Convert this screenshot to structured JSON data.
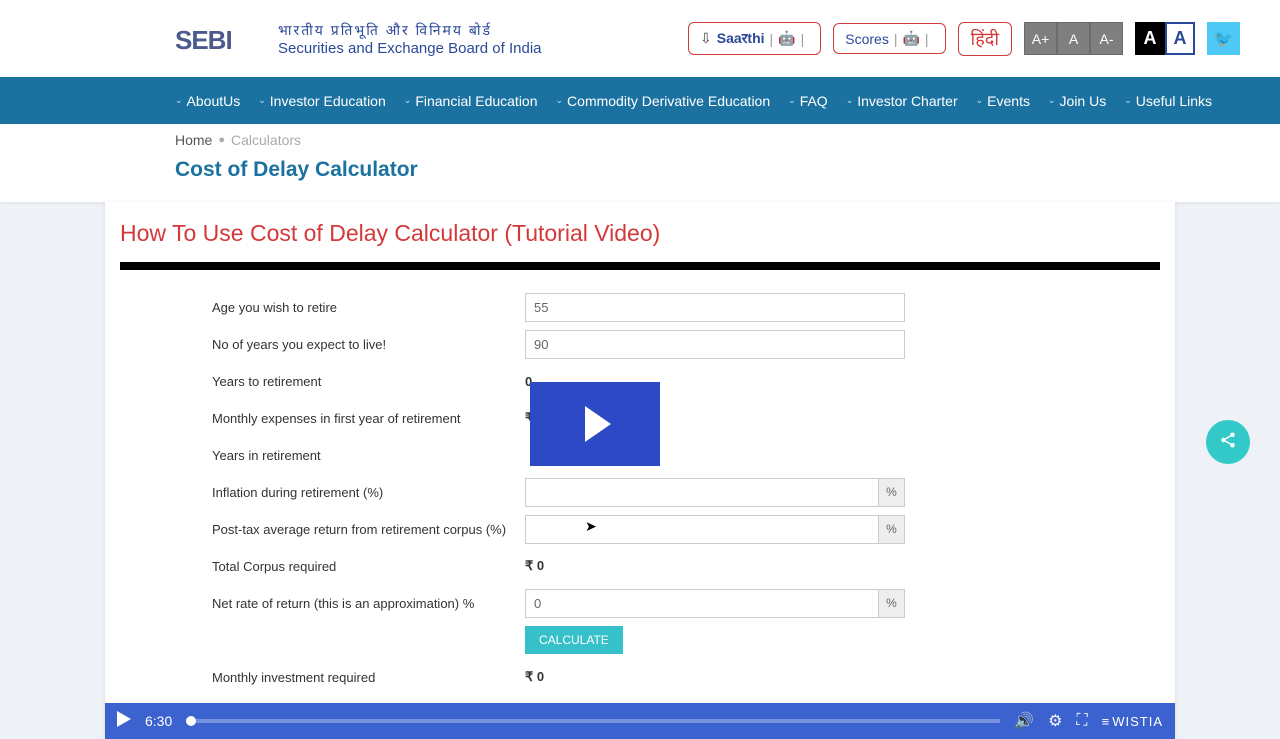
{
  "header": {
    "logo_text": "SEBI",
    "logo_hindi": "भारतीय प्रतिभूति और विनिमय बोर्ड",
    "logo_eng": "Securities and Exchange Board of India",
    "saarthi": "Saaरthi",
    "scores": "Scores",
    "hindi": "हिंदी",
    "font_inc": "A+",
    "font_def": "A",
    "font_dec": "A-",
    "contrast_a": "A"
  },
  "nav": {
    "items": [
      "AboutUs",
      "Investor Education",
      "Financial Education",
      "Commodity Derivative Education",
      "FAQ",
      "Investor Charter",
      "Events",
      "Join Us",
      "Useful Links"
    ]
  },
  "breadcrumb": {
    "home": "Home",
    "current": "Calculators"
  },
  "page_title": "Cost of Delay Calculator",
  "card": {
    "title": "How To Use Cost of Delay Calculator (Tutorial Video)"
  },
  "form": {
    "rows": [
      {
        "label": "Age you wish to retire",
        "type": "input",
        "value": "55"
      },
      {
        "label": "No of years you expect to live!",
        "type": "input",
        "value": "90"
      },
      {
        "label": "Years to retirement",
        "type": "static",
        "value": "0"
      },
      {
        "label": "Monthly expenses in first year of retirement",
        "type": "static",
        "value": "₹ 0"
      },
      {
        "label": "Years in retirement",
        "type": "static",
        "value": ""
      },
      {
        "label": "Inflation during retirement (%)",
        "type": "input_pct",
        "value": ""
      },
      {
        "label": "Post-tax average return from retirement corpus (%)",
        "type": "input_pct",
        "value": ""
      },
      {
        "label": "Total Corpus required",
        "type": "static",
        "value": "₹ 0"
      },
      {
        "label": "Net rate of return (this is an approximation) %",
        "type": "input_pct",
        "value": "0"
      }
    ],
    "calculate": "CALCULATE",
    "monthly_label": "Monthly investment required",
    "monthly_value": "₹ 0",
    "pct_sign": "%"
  },
  "video": {
    "time": "6:30",
    "brand": "WISTIA"
  }
}
